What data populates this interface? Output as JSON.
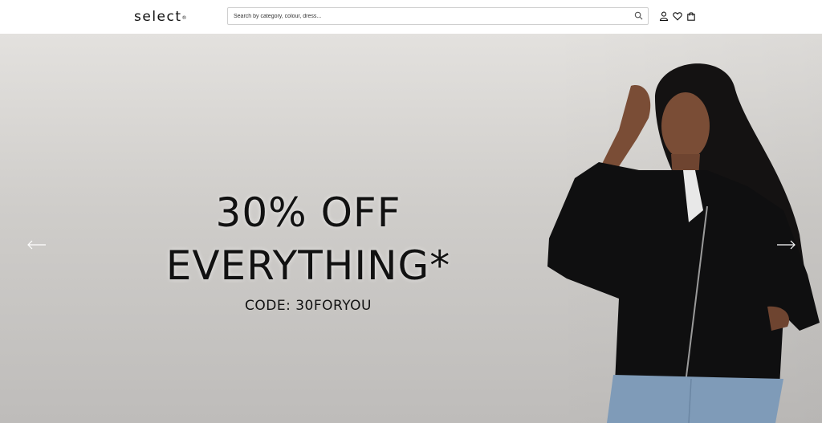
{
  "header": {
    "logo_text": "select",
    "logo_mark": "®",
    "search": {
      "placeholder": "Search by category, colour, dress...",
      "value": ""
    },
    "icons": [
      "search-icon",
      "account-icon",
      "wishlist-heart-icon",
      "shopping-bag-icon"
    ]
  },
  "hero": {
    "headline_line1": "30% OFF",
    "headline_line2": "EVERYTHING*",
    "promo_code": "CODE: 30FORYOU",
    "controls": [
      "arrow-left-icon",
      "arrow-right-icon"
    ],
    "background_color": "#d4d2cf",
    "text_color": "#111111"
  }
}
